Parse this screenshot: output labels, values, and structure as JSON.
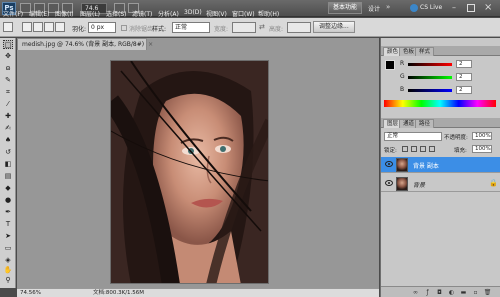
{
  "app": {
    "logo": "Ps"
  },
  "menu": {
    "items": [
      "文件(F)",
      "编辑(E)",
      "图像(I)",
      "图层(L)",
      "选择(S)",
      "滤镜(T)",
      "分析(A)",
      "3D(D)",
      "视图(V)",
      "窗口(W)",
      "帮助(H)"
    ],
    "zoom": "74.6",
    "workspace": "基本功能",
    "design": "设计",
    "cslive": "CS Live"
  },
  "options": {
    "feather_label": "羽化:",
    "feather_value": "0 px",
    "antialias_label": "消除锯齿",
    "style_label": "样式:",
    "style_value": "正常",
    "width_label": "宽度:",
    "height_label": "高度:",
    "refine_edge": "调整边缘..."
  },
  "document": {
    "tab_title": "medish.jpg @ 74.6% (背景 副本, RGB/8#)",
    "close": "×",
    "status_zoom": "74.56%",
    "status_doc": "文档:800.3K/1.56M"
  },
  "color_panel": {
    "tabs": [
      "颜色",
      "色板",
      "样式"
    ],
    "channels": [
      {
        "label": "R",
        "value": "2"
      },
      {
        "label": "G",
        "value": "2"
      },
      {
        "label": "B",
        "value": "2"
      }
    ]
  },
  "layers_panel": {
    "tabs": [
      "图层",
      "通道",
      "路径"
    ],
    "blend_mode": "正常",
    "opacity_label": "不透明度:",
    "opacity_value": "100%",
    "lock_label": "锁定:",
    "fill_label": "填充:",
    "fill_value": "100%",
    "layers": [
      {
        "name": "背景 副本",
        "selected": true
      },
      {
        "name": "背景",
        "selected": false
      }
    ]
  },
  "colors": {
    "selection": "#3c8ee6",
    "fg": "#000000",
    "bg": "#a0522d"
  }
}
